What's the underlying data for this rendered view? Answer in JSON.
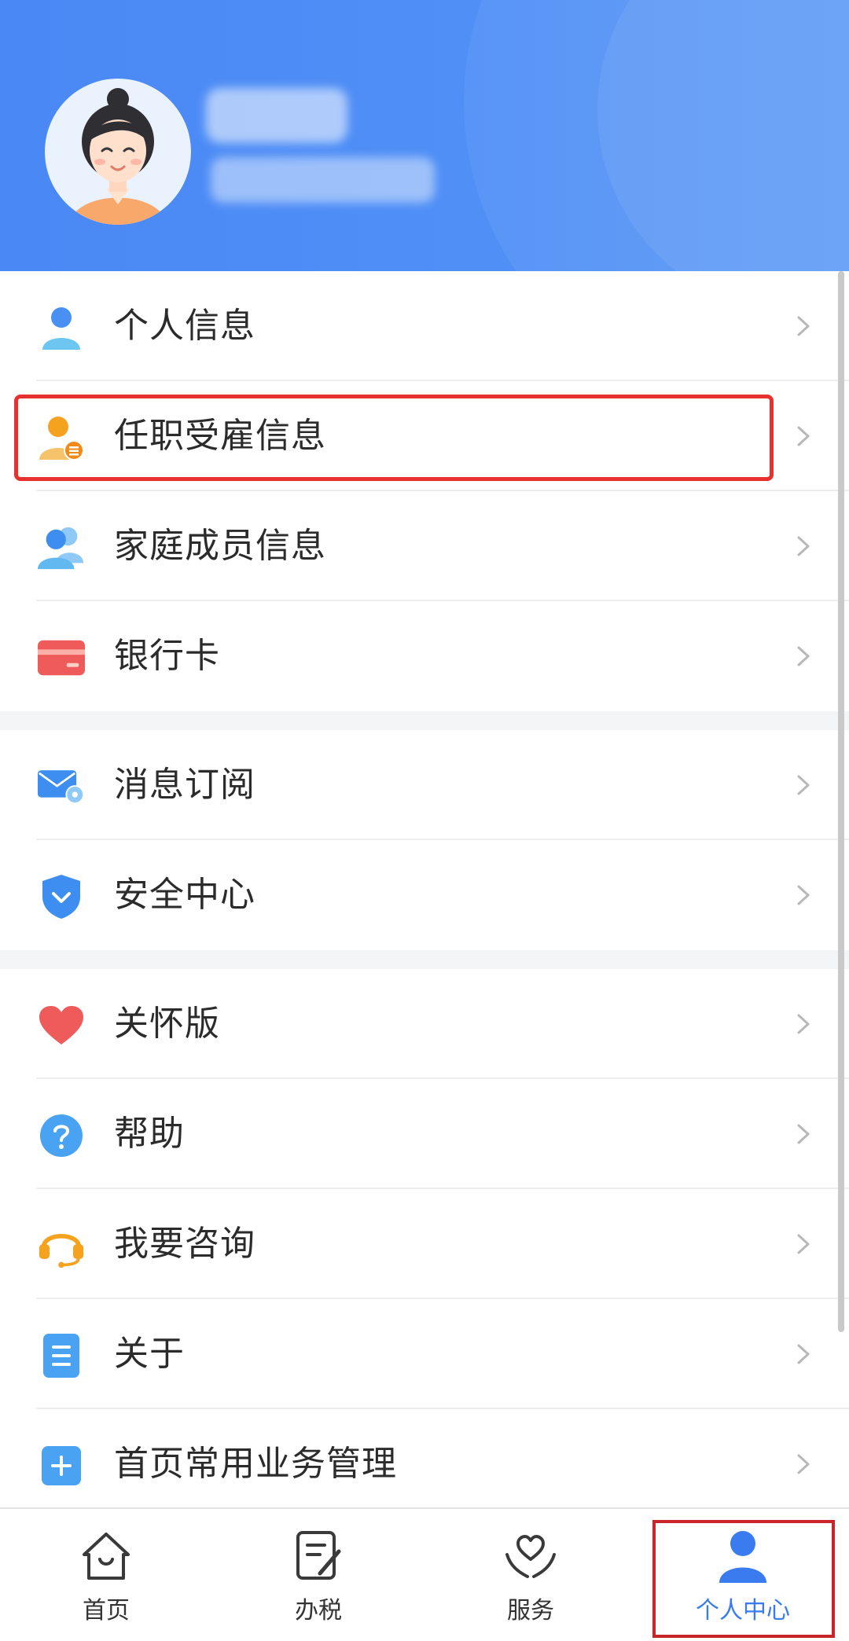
{
  "header": {
    "avatar": "avatar-illustration",
    "user_name": "",
    "user_id": ""
  },
  "menu_groups": [
    {
      "items": [
        {
          "label": "个人信息",
          "icon": "person-icon"
        },
        {
          "label": "任职受雇信息",
          "icon": "employment-icon"
        },
        {
          "label": "家庭成员信息",
          "icon": "family-icon"
        },
        {
          "label": "银行卡",
          "icon": "bank-card-icon"
        }
      ]
    },
    {
      "items": [
        {
          "label": "消息订阅",
          "icon": "mail-settings-icon"
        },
        {
          "label": "安全中心",
          "icon": "shield-icon"
        }
      ]
    },
    {
      "items": [
        {
          "label": "关怀版",
          "icon": "heart-icon"
        },
        {
          "label": "帮助",
          "icon": "question-icon"
        },
        {
          "label": "我要咨询",
          "icon": "headset-icon"
        },
        {
          "label": "关于",
          "icon": "document-icon"
        },
        {
          "label": "首页常用业务管理",
          "icon": "plus-square-icon"
        }
      ]
    }
  ],
  "tabbar": {
    "tabs": [
      {
        "label": "首页",
        "icon": "home-icon"
      },
      {
        "label": "办税",
        "icon": "edit-doc-icon"
      },
      {
        "label": "服务",
        "icon": "heart-hands-icon"
      },
      {
        "label": "个人中心",
        "icon": "user-icon"
      }
    ],
    "active_index": 3
  },
  "colors": {
    "header_blue": "#4a88f5",
    "highlight_red": "#e8312f",
    "active_tab": "#3a7cf0",
    "label_text": "#2b2b2b"
  }
}
